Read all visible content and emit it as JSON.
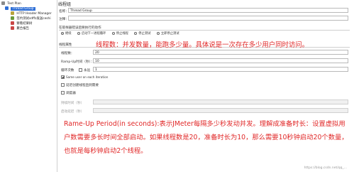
{
  "sidebar": {
    "items": [
      {
        "label": "Test Plan",
        "color": "#8a8a8a"
      },
      {
        "label": "Thread Group",
        "color": "#2f6fd6"
      },
      {
        "label": "HTTP Header Manager",
        "color": "#b8a33c"
      },
      {
        "label": "签约测试sdffz发送ceshi",
        "color": "#6b9b3b"
      },
      {
        "label": "察看结果树",
        "color": "#c94545"
      },
      {
        "label": "聚合报告",
        "color": "#c94545"
      }
    ]
  },
  "main": {
    "title": "线程组",
    "name_label": "名称：",
    "name_value": "Thread Group",
    "comment_label": "注释：",
    "sampler_error_label": "在取样器错误后要执行的动作",
    "radios": [
      {
        "label": "继续",
        "checked": true
      },
      {
        "label": "启动下一进程循环",
        "checked": false
      },
      {
        "label": "停止线程",
        "checked": false
      },
      {
        "label": "停止测试",
        "checked": false
      },
      {
        "label": "立即停止测试",
        "checked": false
      }
    ],
    "thread_props_label": "线程属性",
    "thread_count_label": "线程数：",
    "thread_count_value": "20",
    "rampup_label": "Ramp-Up时间（秒）：",
    "rampup_value": "10",
    "loop_label": "循环次数",
    "forever_label": "永远",
    "loop_value": "1",
    "same_user_label": "Same user on each iteration",
    "delay_label": "延迟创建线程直到需要",
    "scheduler_label": "调度器",
    "duration_label": "持续时间（秒）",
    "startup_delay_label": "启动延迟（秒）"
  },
  "annotations": {
    "top": "线程数：并发数量，能跑多少量。具体说是一次存在多少用户同时访问。",
    "bottom": "Rame-Up Period(in seconds):表示JMeter每隔多少秒发动并发。理解成准备时长：设置虚拟用户数需要多长时间全部启动。如果线程数是20，准备时长为10，那么需要10秒钟启动20个数量，也就是每秒钟启动2个线程。"
  },
  "watermark": "https://blog.csdn.net/qq_..."
}
